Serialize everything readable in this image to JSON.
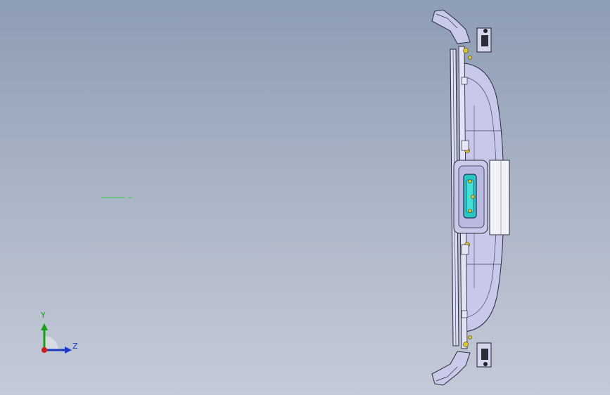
{
  "viewport": {
    "background_top": "#8d9db4",
    "background_bottom": "#c4cad7"
  },
  "triad": {
    "y_label": "Y",
    "z_label": "Z",
    "y_color": "#15a315",
    "z_color": "#1b39c9",
    "origin_color": "#d21b1b"
  },
  "model": {
    "description_icon": "bumper-assembly-edge-view",
    "body_color": "#c9c9ea",
    "edge_color": "#2b2b3c",
    "highlight_color": "#28c7c2",
    "fastener_color": "#d9c43a"
  }
}
